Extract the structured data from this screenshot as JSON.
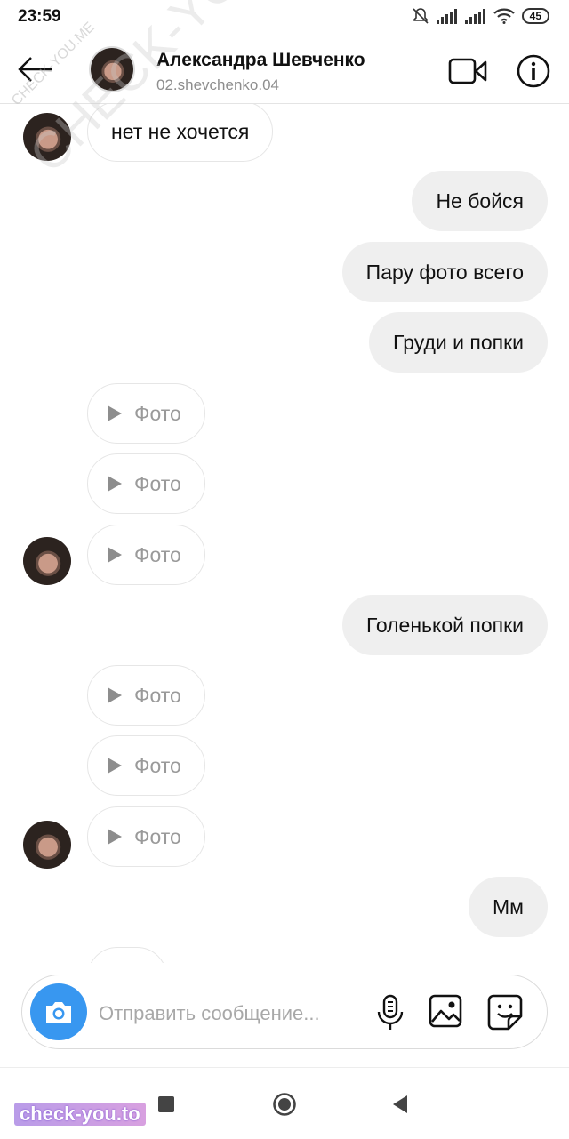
{
  "status_bar": {
    "time": "23:59",
    "battery": "45"
  },
  "header": {
    "name": "Александра Шевченко",
    "username": "02.shevchenko.04"
  },
  "messages": [
    {
      "dir": "in",
      "type": "text",
      "text": "нет не хочется",
      "avatar": true
    },
    {
      "dir": "out",
      "type": "text",
      "text": "Не бойся"
    },
    {
      "dir": "out",
      "type": "text",
      "text": "Пару фото всего"
    },
    {
      "dir": "out",
      "type": "text",
      "text": "Груди и попки"
    },
    {
      "dir": "in",
      "type": "photo",
      "text": "Фото",
      "avatar": false
    },
    {
      "dir": "in",
      "type": "photo",
      "text": "Фото",
      "avatar": false
    },
    {
      "dir": "in",
      "type": "photo",
      "text": "Фото",
      "avatar": true
    },
    {
      "dir": "out",
      "type": "text",
      "text": "Голенькой попки"
    },
    {
      "dir": "in",
      "type": "photo",
      "text": "Фото",
      "avatar": false
    },
    {
      "dir": "in",
      "type": "photo",
      "text": "Фото",
      "avatar": false
    },
    {
      "dir": "in",
      "type": "photo",
      "text": "Фото",
      "avatar": true
    },
    {
      "dir": "out",
      "type": "text",
      "text": "Мм"
    }
  ],
  "composer": {
    "placeholder": "Отправить сообщение..."
  },
  "watermarks": {
    "diagonal": "CHECK-YOU.ME",
    "small": "CHECK-YOU.ME",
    "bottom": "check-you.to"
  },
  "colors": {
    "accent": "#3897f0",
    "outgoing_bubble": "#efefef",
    "secondary_text": "#8e8e8e"
  }
}
